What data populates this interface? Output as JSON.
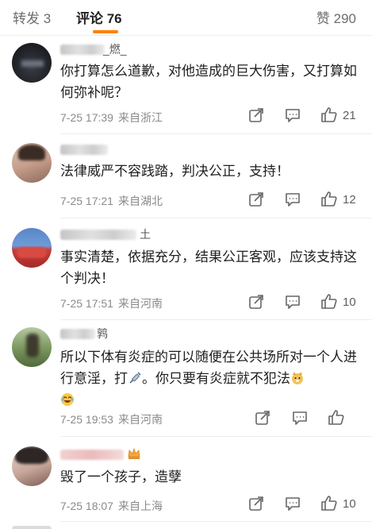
{
  "tabs": {
    "repost": "转发 3",
    "comments": "评论 76",
    "likes": "赞 290"
  },
  "colors": {
    "accent": "#ff8200",
    "meta_text": "#8a8a8a"
  },
  "comments": [
    {
      "username_visible": "_燃_",
      "text": "你打算怎么道歉，对他造成的巨大伤害，又打算如何弥补呢？",
      "time": "7-25 17:39",
      "location": "来自浙江",
      "likes": "21"
    },
    {
      "username_visible": "",
      "text": "法律威严不容践踏，判决公正，支持！",
      "time": "7-25 17:21",
      "location": "来自湖北",
      "likes": "12"
    },
    {
      "username_visible": "土",
      "text": "事实清楚，依据充分，结果公正客观，应该支持这个判决！",
      "time": "7-25 17:51",
      "location": "来自河南",
      "likes": "10"
    },
    {
      "username_visible": "鹑",
      "text_part1": "所以下体有炎症的可以随便在公共场所对一个人进行意淫，打",
      "text_part2": "。你只要有炎症就不犯法",
      "time": "7-25 19:53",
      "location": "来自河南",
      "likes": ""
    },
    {
      "username_visible": "",
      "text": "毁了一个孩子，造孽",
      "time": "7-25 18:07",
      "location": "来自上海",
      "likes": "10"
    }
  ],
  "icons": {
    "share": "share-icon",
    "comment": "comment-icon",
    "like": "thumbs-up-icon"
  }
}
